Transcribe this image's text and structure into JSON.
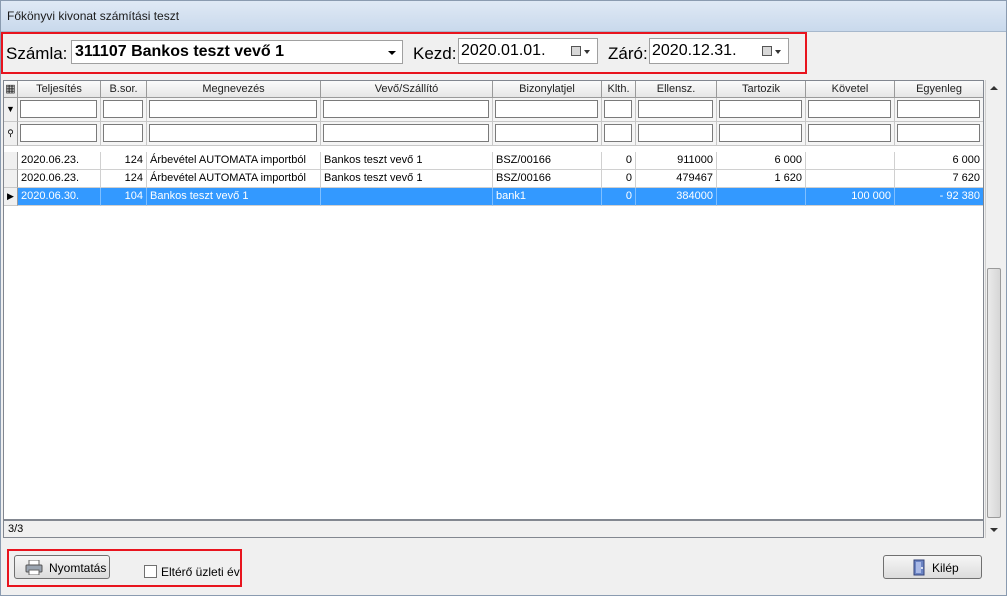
{
  "window": {
    "title": "Főkönyvi kivonat számítási teszt"
  },
  "toolbar": {
    "account_label": "Számla:",
    "account_value": "311107 Bankos teszt vevő 1",
    "start_label": "Kezd:",
    "start_value": "2020.01.01.",
    "end_label": "Záró:",
    "end_value": "2020.12.31."
  },
  "grid": {
    "columns": [
      "Teljesítés",
      "B.sor.",
      "Megnevezés",
      "Vevő/Szállító",
      "Bizonylatjel",
      "Klth.",
      "Ellensz.",
      "Tartozik",
      "Követel",
      "Egyenleg"
    ],
    "rows": [
      [
        "2020.06.23.",
        "124",
        "Árbevétel AUTOMATA importból",
        "Bankos teszt vevő 1",
        "BSZ/00166",
        "0",
        "911000",
        "6 000",
        "",
        "6 000"
      ],
      [
        "2020.06.23.",
        "124",
        "Árbevétel AUTOMATA importból",
        "Bankos teszt vevő 1",
        "BSZ/00166",
        "0",
        "479467",
        "1 620",
        "",
        "7 620"
      ],
      [
        "2020.06.30.",
        "104",
        "Bankos teszt vevő 1",
        "",
        "bank1",
        "0",
        "384000",
        "",
        "100 000",
        "- 92 380"
      ]
    ],
    "selected_row": 2
  },
  "status": {
    "record_count": "3/3"
  },
  "footer": {
    "print_label": "Nyomtatás",
    "diff_year_label": "Eltérő üzleti év",
    "exit_label": "Kilép"
  },
  "colors": {
    "highlight": "#e8141e",
    "selection": "#3399ff"
  }
}
